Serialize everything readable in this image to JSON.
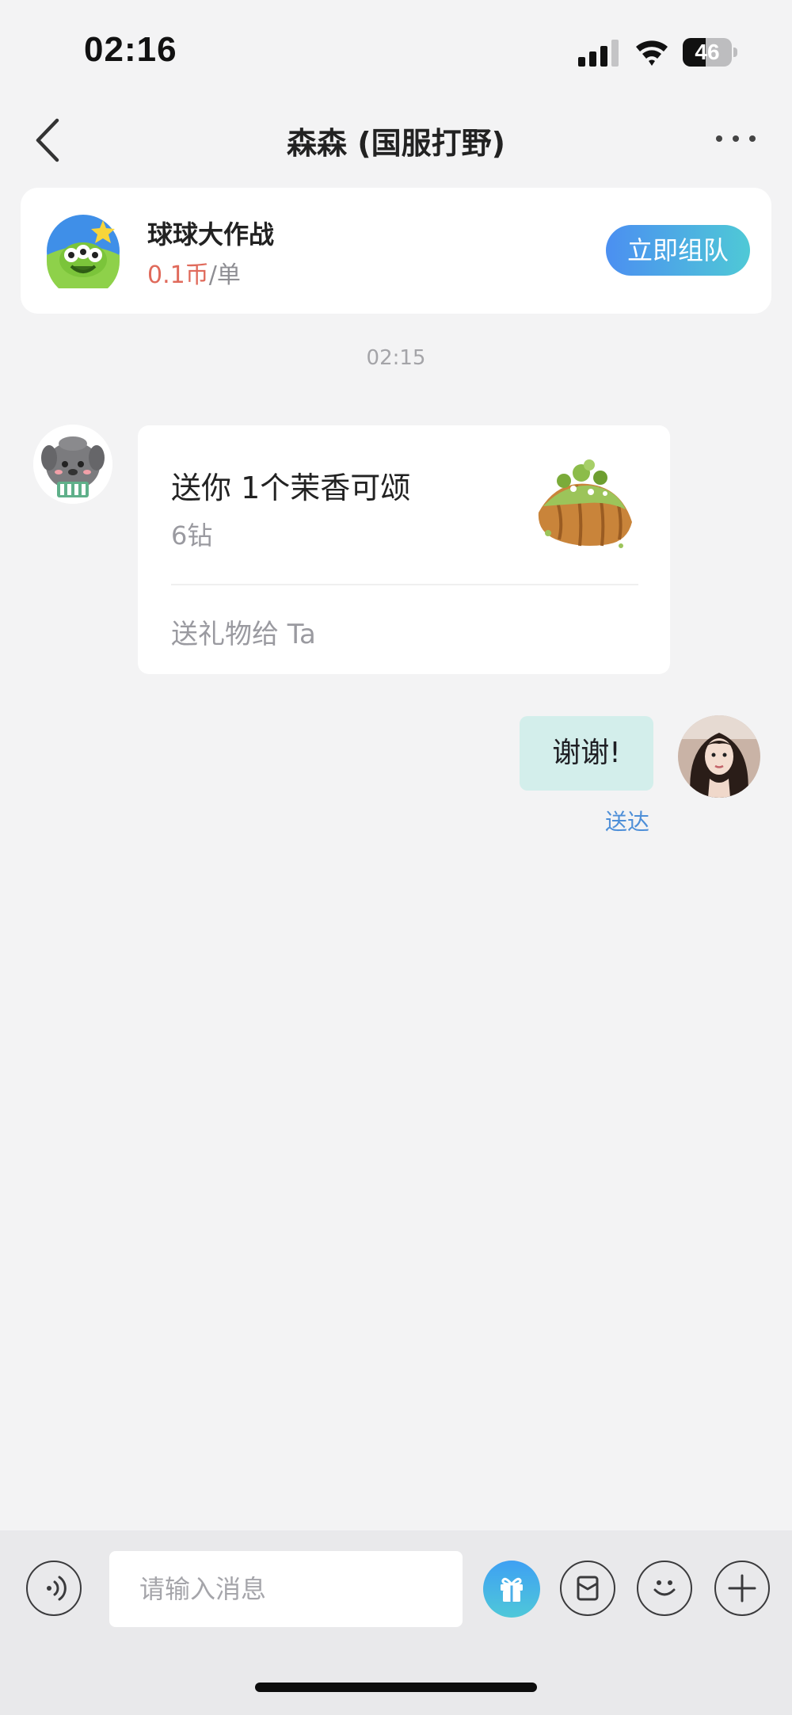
{
  "status_bar": {
    "time": "02:16",
    "battery": "46",
    "battery_level": 0.46
  },
  "nav": {
    "title": "森森 (国服打野)"
  },
  "game_card": {
    "name": "球球大作战",
    "price": "0.1币",
    "unit": "/单",
    "button": "立即组队"
  },
  "chat": {
    "timestamp": "02:15",
    "gift": {
      "title": "送你 1个茉香可颂",
      "price": "6钻",
      "action": "送礼物给 Ta"
    },
    "my_message": {
      "text": "谢谢!",
      "status": "送达"
    }
  },
  "input": {
    "placeholder": "请输入消息"
  },
  "icons": [
    "back-icon",
    "more-icon",
    "voice-icon",
    "gift-icon",
    "pocket-icon",
    "emoji-icon",
    "plus-icon"
  ],
  "colors": {
    "accent_start": "#4b8ff1",
    "accent_end": "#4fc9d6",
    "price": "#e06a5b",
    "bubble": "#d3eeeb",
    "status": "#4e8fd8"
  }
}
